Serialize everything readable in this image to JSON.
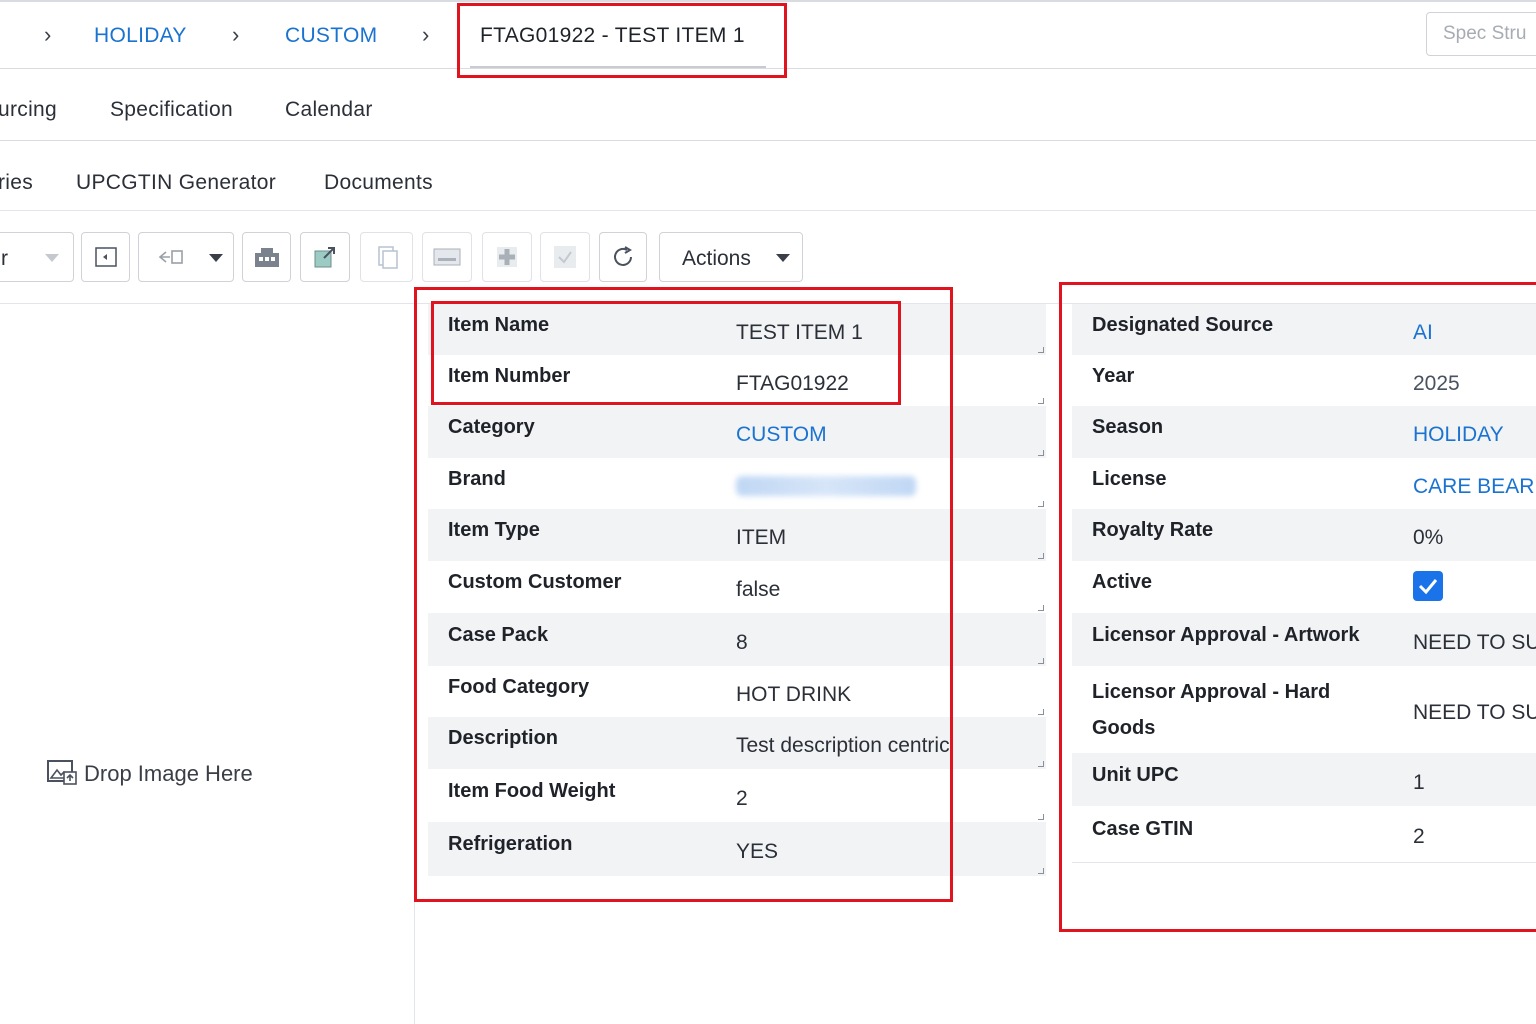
{
  "breadcrumb": {
    "items": [
      "HOLIDAY",
      "CUSTOM"
    ],
    "current": "FTAG01922 - TEST ITEM 1",
    "search_placeholder": "Spec Stru"
  },
  "tabs_row1": [
    "urcing",
    "Specification",
    "Calendar"
  ],
  "tabs_row2": [
    "ries",
    "UPCGTIN Generator",
    "Documents"
  ],
  "toolbar": {
    "select_fragment": "r",
    "actions_label": "Actions"
  },
  "drop_zone": {
    "label": "Drop Image Here",
    "icon": "image-upload-icon"
  },
  "details_left": [
    {
      "label": "Item Name",
      "value": "TEST ITEM 1"
    },
    {
      "label": "Item Number",
      "value": "FTAG01922"
    },
    {
      "label": "Category",
      "value": "CUSTOM",
      "link": true
    },
    {
      "label": "Brand",
      "value": "",
      "redacted": true
    },
    {
      "label": "Item Type",
      "value": "ITEM"
    },
    {
      "label": "Custom Customer",
      "value": "false"
    },
    {
      "label": "Case Pack",
      "value": "8"
    },
    {
      "label": "Food Category",
      "value": "HOT DRINK"
    },
    {
      "label": "Description",
      "value": "Test description centric"
    },
    {
      "label": "Item Food Weight",
      "value": "2"
    },
    {
      "label": "Refrigeration",
      "value": "YES"
    }
  ],
  "details_right": [
    {
      "label": "Designated Source",
      "value": "AI",
      "link": true
    },
    {
      "label": "Year",
      "value": "2025"
    },
    {
      "label": "Season",
      "value": "HOLIDAY",
      "link": true
    },
    {
      "label": "License",
      "value": "CARE BEAR",
      "link": true
    },
    {
      "label": "Royalty Rate",
      "value": "0%"
    },
    {
      "label": "Active",
      "value": "",
      "checked": true
    },
    {
      "label": "Licensor Approval - Artwork",
      "value": "NEED TO SU"
    },
    {
      "label": "Licensor Approval - Hard Goods",
      "value": "NEED TO SU"
    },
    {
      "label": "Unit UPC",
      "value": "1"
    },
    {
      "label": "Case GTIN",
      "value": "2"
    }
  ],
  "colors": {
    "link": "#1a73d0",
    "highlight": "#e0141e",
    "row_shade": "#f2f3f5",
    "checkbox": "#1a73e8"
  }
}
